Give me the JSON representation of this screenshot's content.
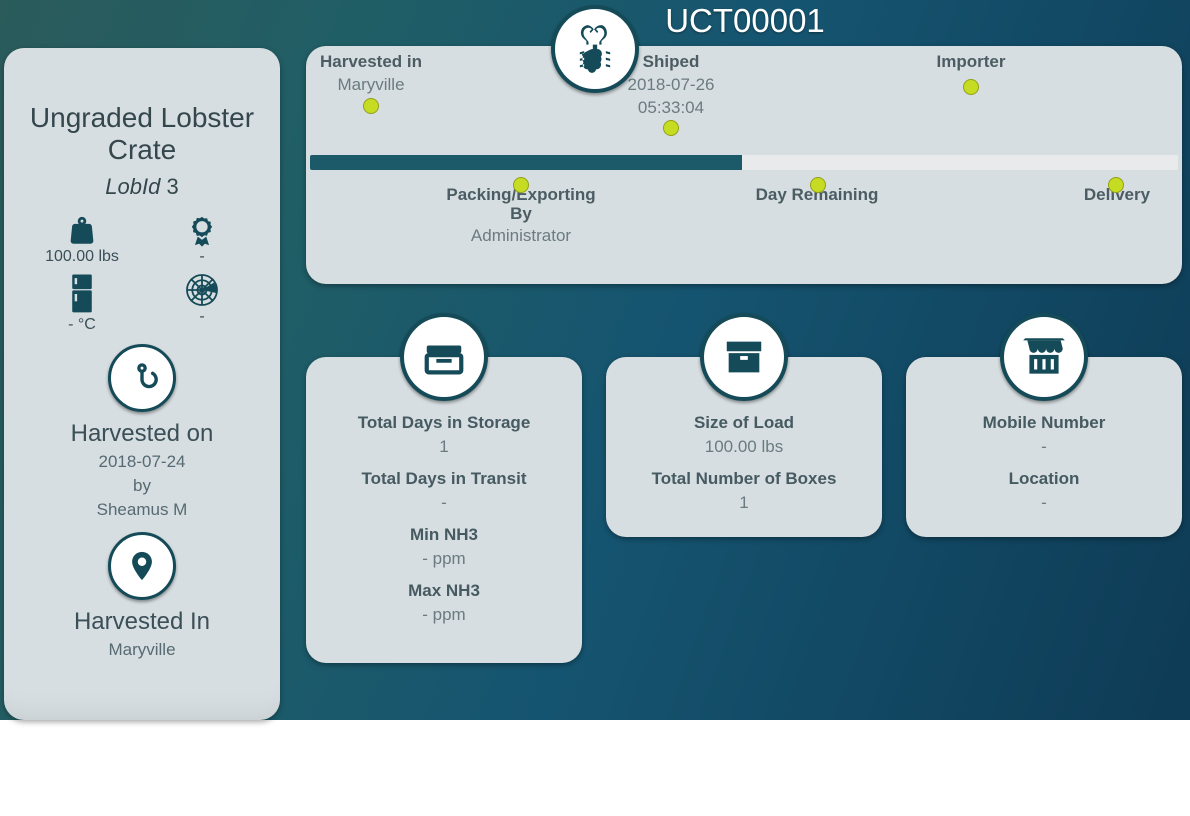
{
  "page_title": "UCT00001",
  "sidebar": {
    "title": "Ungraded Lobster Crate",
    "lobid_label": "LobId",
    "lobid_value": "3",
    "weight": "100.00 lbs",
    "quality": "-",
    "temp": "- °C",
    "compass": "-",
    "harvested_on_label": "Harvested on",
    "harvested_on_date": "2018-07-24",
    "by_label": "by",
    "harvested_by": "Sheamus M",
    "harvested_in_label": "Harvested In",
    "harvested_in_value": "Maryville"
  },
  "timeline": {
    "progress_pct": 49.8,
    "harvested_in": {
      "label": "Harvested in",
      "value": "Maryville"
    },
    "shipped": {
      "label": "Shiped",
      "value1": "2018-07-26",
      "value2": "05:33:04"
    },
    "importer": {
      "label": "Importer"
    },
    "packing": {
      "label": "Packing/Exporting By",
      "value": "Administrator"
    },
    "day_remaining": {
      "label": "Day Remaining"
    },
    "delivery": {
      "label": "Delivery"
    }
  },
  "cards": {
    "storage": {
      "k1": "Total Days in Storage",
      "v1": "1",
      "k2": "Total Days in Transit",
      "v2": "-",
      "k3": "Min NH3",
      "v3": "- ppm",
      "k4": "Max NH3",
      "v4": "- ppm"
    },
    "load": {
      "k1": "Size of Load",
      "v1": "100.00 lbs",
      "k2": "Total Number of Boxes",
      "v2": "1"
    },
    "retail": {
      "k1": "Mobile Number",
      "v1": "-",
      "k2": "Location",
      "v2": "-"
    }
  }
}
